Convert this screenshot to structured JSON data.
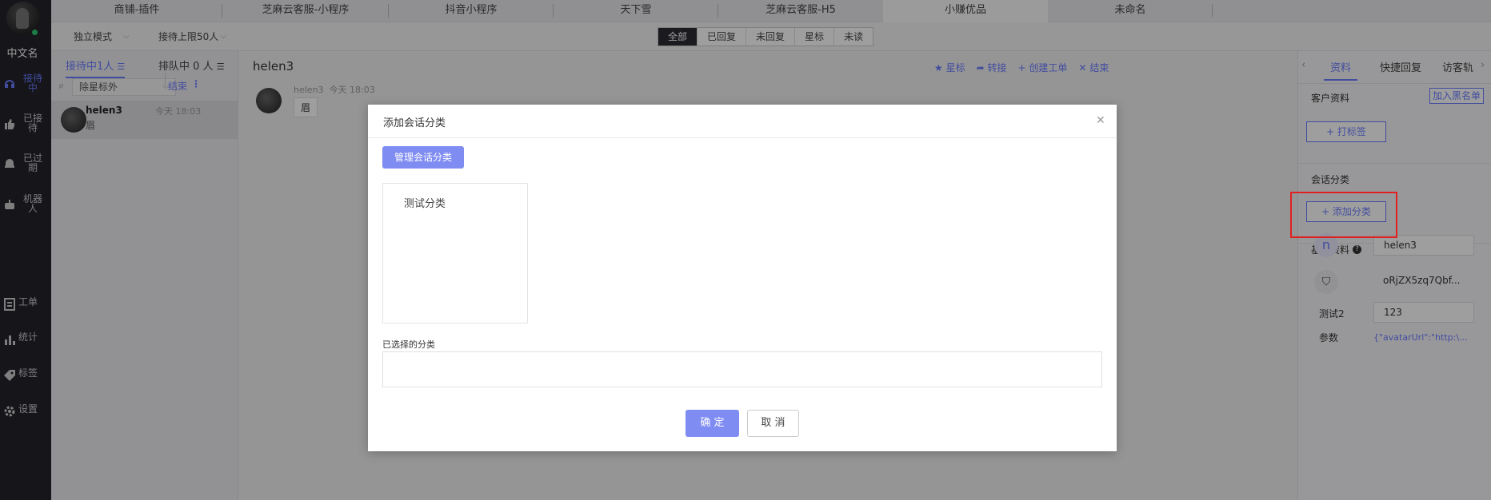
{
  "sidebar": {
    "user_name": "中文名",
    "items": [
      {
        "label": "接待中",
        "icon": "headset-icon"
      },
      {
        "label": "已接待",
        "icon": "thumb-up-icon"
      },
      {
        "label": "已过期",
        "icon": "alarm-icon"
      },
      {
        "label": "机器人",
        "icon": "robot-icon"
      },
      {
        "label": "工单",
        "icon": "ticket-icon"
      },
      {
        "label": "统计",
        "icon": "bar-chart-icon"
      },
      {
        "label": "标签",
        "icon": "tag-icon"
      },
      {
        "label": "设置",
        "icon": "gear-icon"
      }
    ]
  },
  "top_tabs": [
    "商铺-插件",
    "芝麻云客服-小程序",
    "抖音小程序",
    "天下雪",
    "芝麻云客服-H5",
    "小赚优品",
    "未命名"
  ],
  "toolbar": {
    "mode": "独立模式",
    "limit": "接待上限50人",
    "filters": [
      "全部",
      "已回复",
      "未回复",
      "星标",
      "未读"
    ],
    "active_filter": "全部"
  },
  "conv_list": {
    "tab_active": "接待中1人",
    "tab_queue": "排队中 0 人",
    "filter_select": "除星标外",
    "end_label": "结束",
    "items": [
      {
        "name": "helen3",
        "time": "今天 18:03",
        "preview": "眉"
      }
    ]
  },
  "chat": {
    "title": "helen3",
    "actions": [
      "星标",
      "转接",
      "创建工单",
      "结束"
    ],
    "message": {
      "sender": "helen3",
      "time": "今天 18:03",
      "text": "眉"
    }
  },
  "right_panel": {
    "tabs": [
      "资料",
      "快捷回复",
      "访客轨"
    ],
    "customer_info_title": "客户资料",
    "blacklist_button": "加入黑名单",
    "tag_button": "+ 打标签",
    "session_category_title": "会话分类",
    "add_category_button": "+ 添加分类",
    "basic_info_title": "基本资料",
    "fields": [
      {
        "label": "",
        "value": "helen3"
      },
      {
        "label": "",
        "value": "oRjZX5zq7Qbf..."
      },
      {
        "label": "测试2",
        "value": "123"
      },
      {
        "label": "参数",
        "value": "{\"avatarUrl\":\"http:\\..."
      }
    ]
  },
  "dialog": {
    "title": "添加会话分类",
    "manage_button": "管理会话分类",
    "categories": [
      "测试分类"
    ],
    "selected_label": "已选择的分类",
    "confirm": "确 定",
    "cancel": "取 消"
  },
  "colors": {
    "accent": "#6c7cff",
    "nav_bg": "#23232b",
    "highlight": "#e02020"
  }
}
